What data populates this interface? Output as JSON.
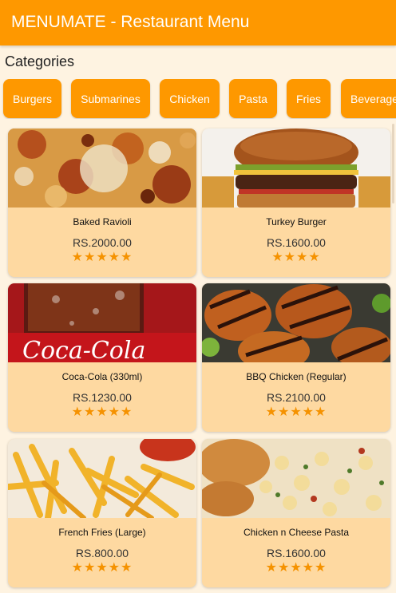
{
  "app_bar": {
    "title": "MENUMATE - Restaurant Menu"
  },
  "categories": {
    "heading": "Categories",
    "items": [
      "Burgers",
      "Submarines",
      "Chicken",
      "Pasta",
      "Fries",
      "Beverages"
    ]
  },
  "menu_items": [
    {
      "name": "Baked Ravioli",
      "price": "RS.2000.00",
      "rating": 5,
      "stars": "★★★★★",
      "image": "ravioli-photo"
    },
    {
      "name": "Turkey Burger",
      "price": "RS.1600.00",
      "rating": 4,
      "stars": "★★★★",
      "image": "burger-photo"
    },
    {
      "name": "Coca-Cola (330ml)",
      "price": "RS.1230.00",
      "rating": 5,
      "stars": "★★★★★",
      "image": "coca-cola-photo"
    },
    {
      "name": "BBQ Chicken (Regular)",
      "price": "RS.2100.00",
      "rating": 5,
      "stars": "★★★★★",
      "image": "bbq-chicken-photo"
    },
    {
      "name": "French Fries (Large)",
      "price": "RS.800.00",
      "rating": 5,
      "stars": "★★★★★",
      "image": "fries-photo"
    },
    {
      "name": "Chicken n Cheese Pasta",
      "price": "RS.1600.00",
      "rating": 5,
      "stars": "★★★★★",
      "image": "pasta-photo"
    }
  ],
  "logo_text": "Coca-Cola",
  "colors": {
    "primary": "#fe9800",
    "background": "#fef3e1",
    "card": "#fed9a1",
    "star": "#f59200"
  }
}
